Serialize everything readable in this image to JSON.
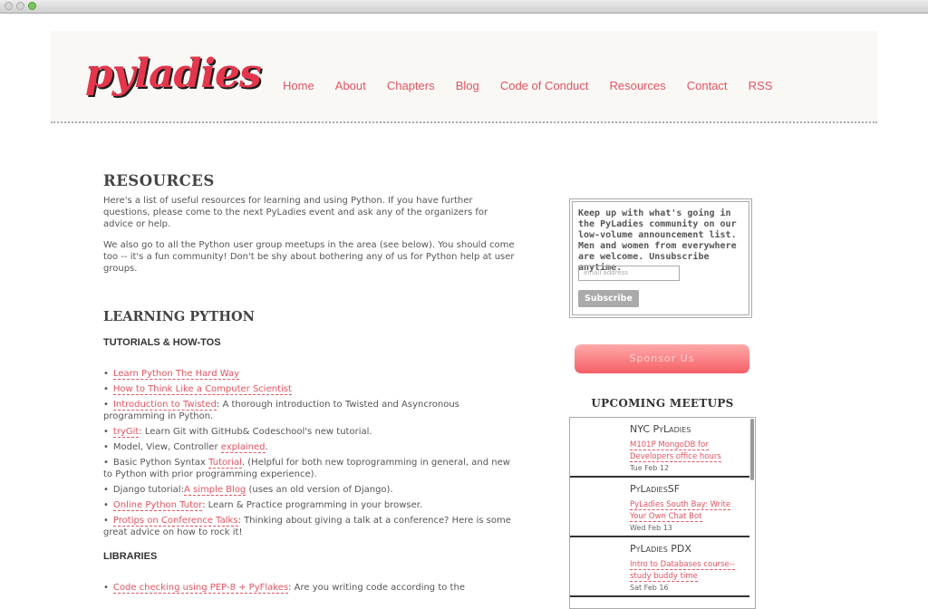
{
  "nav": [
    "Home",
    "About",
    "Chapters",
    "Blog",
    "Code of Conduct",
    "Resources",
    "Contact",
    "RSS"
  ],
  "logo": "pyladies",
  "page_title": "RESOURCES",
  "intro1": "Here's a list of useful resources for learning and using Python. If you have further questions, please come to the next PyLadies event and ask any of the organizers for advice or help.",
  "intro2": "We also go to all the Python user group meetups in the area (see below). You should come too -- it's a fun community! Don't be shy about bothering any of us for Python help at user groups.",
  "section_learning": "LEARNING PYTHON",
  "sub_tutorials": "TUTORIALS & HOW-TOS",
  "tutorials": [
    {
      "link": "Learn Python The Hard Way",
      "pre": "",
      "post": ""
    },
    {
      "link": "How to Think Like a Computer Scientist",
      "pre": "",
      "post": ""
    },
    {
      "link": "Introduction to Twisted",
      "pre": "",
      "post": ": A thorough introduction to Twisted and Asyncronous programming in Python."
    },
    {
      "link": "tryGit",
      "pre": "",
      "post": ": Learn Git with GitHub& Codeschool's new tutorial."
    },
    {
      "link": "explained",
      "pre": "Model, View, Controller ",
      "post": "."
    },
    {
      "link": "Tutorial",
      "pre": "Basic Python Syntax ",
      "post": ". (Helpful for both new toprogramming in general, and new to Python with prior programming experience)."
    },
    {
      "link": "A simple Blog",
      "pre": "Django tutorial:",
      "post": " (uses an old version of Django)."
    },
    {
      "link": "Online Python Tutor",
      "pre": "",
      "post": ": Learn & Practice programming in your browser."
    },
    {
      "link": "Protips on Conference Talks",
      "pre": "",
      "post": ": Thinking about giving a talk at a conference? Here is some great advice on how to rock it!"
    }
  ],
  "sub_libraries": "LIBRARIES",
  "libraries": [
    {
      "link": "Code checking using PEP-8 + PyFlakes",
      "pre": "",
      "post": ": Are you writing code according to the"
    }
  ],
  "signup": {
    "text": "Keep up with what's going in the PyLadies community on our low-volume announcement list. Men and women from everywhere are welcome. Unsubscribe anytime.",
    "placeholder": "email address",
    "button": "Subscribe"
  },
  "sponsor": "Sponsor Us",
  "meetups_title": "UPCOMING MEETUPS",
  "meetups": [
    {
      "group": "NYC PyLadies",
      "title": "M101P MongoDB for Developers office hours",
      "date": "Tue Feb 12"
    },
    {
      "group": "PyLadiesSF",
      "title": "PyLadies South Bay: Write Your Own Chat Bot",
      "date": "Wed Feb 13"
    },
    {
      "group": "PyLadies PDX",
      "title": "Intro to Databases course-- study buddy time",
      "date": "Sat Feb 16"
    }
  ]
}
